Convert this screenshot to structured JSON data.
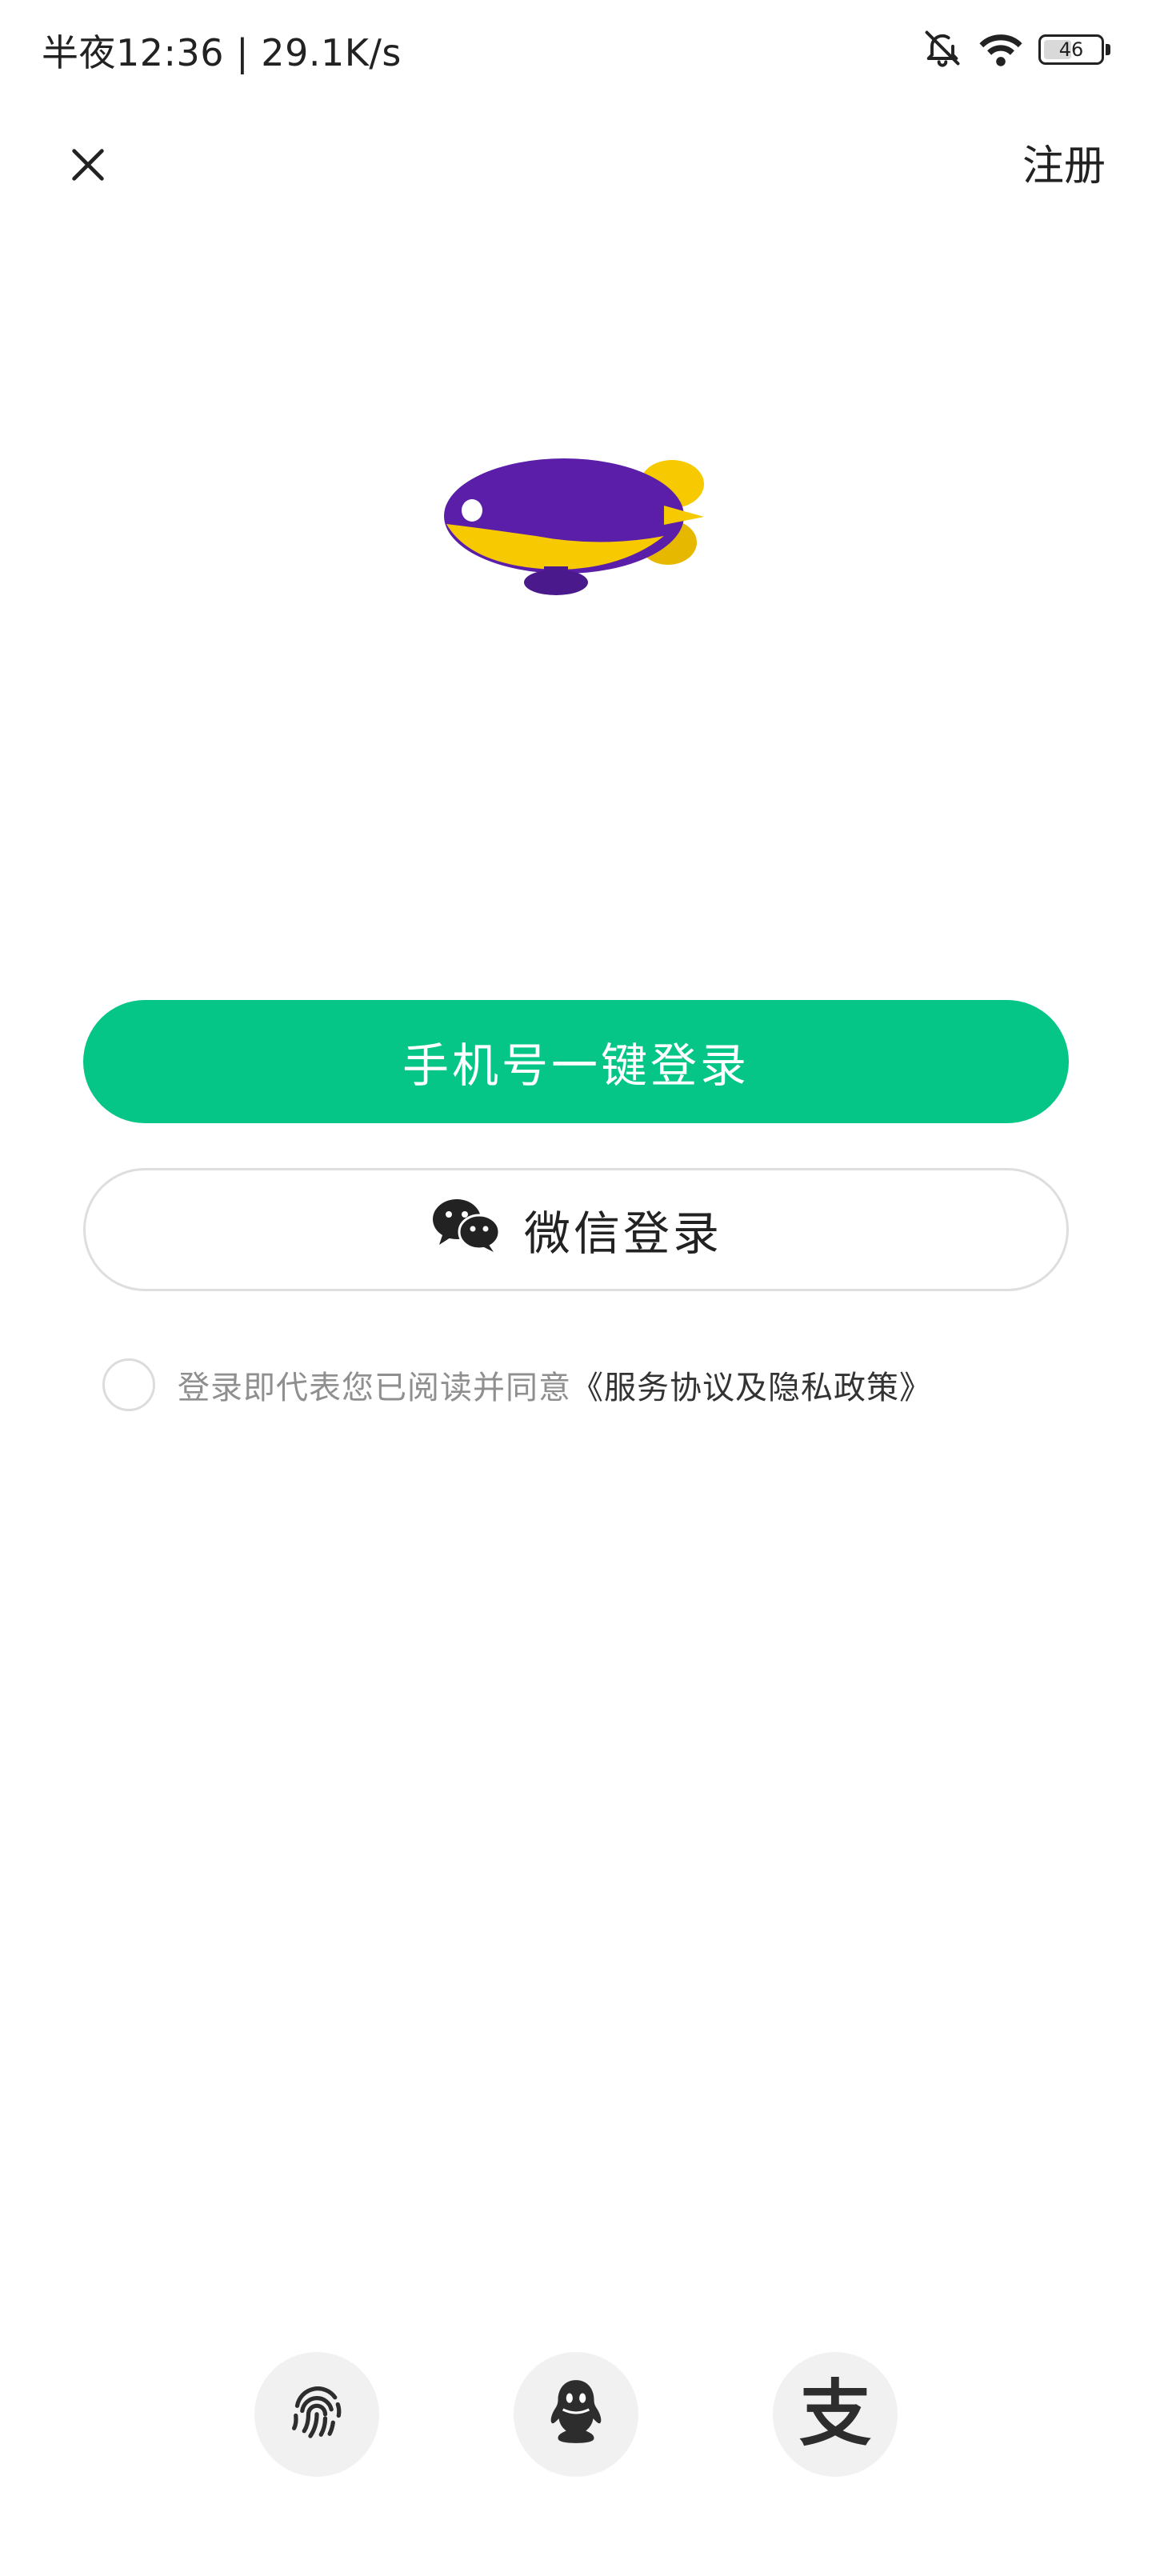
{
  "status_bar": {
    "time_text": "半夜12:36 | 29.1K/s",
    "battery_level": "46",
    "icons": [
      "bell-off-icon",
      "wifi-icon",
      "battery-icon"
    ]
  },
  "header": {
    "close_icon": "close-icon",
    "register_label": "注册"
  },
  "brand": {
    "mascot": "blimp-mascot"
  },
  "login": {
    "phone_button_label": "手机号一键登录",
    "phone_button_color": "#06c687",
    "wechat_button_label": "微信登录",
    "wechat_icon": "wechat-icon"
  },
  "agreement": {
    "checked": false,
    "text": "登录即代表您已阅读并同意",
    "link_text": "《服务协议及隐私政策》"
  },
  "third_party": {
    "fingerprint_icon": "fingerprint-icon",
    "qq_icon": "qq-icon",
    "alipay_icon": "alipay-icon",
    "alipay_glyph": "支"
  }
}
